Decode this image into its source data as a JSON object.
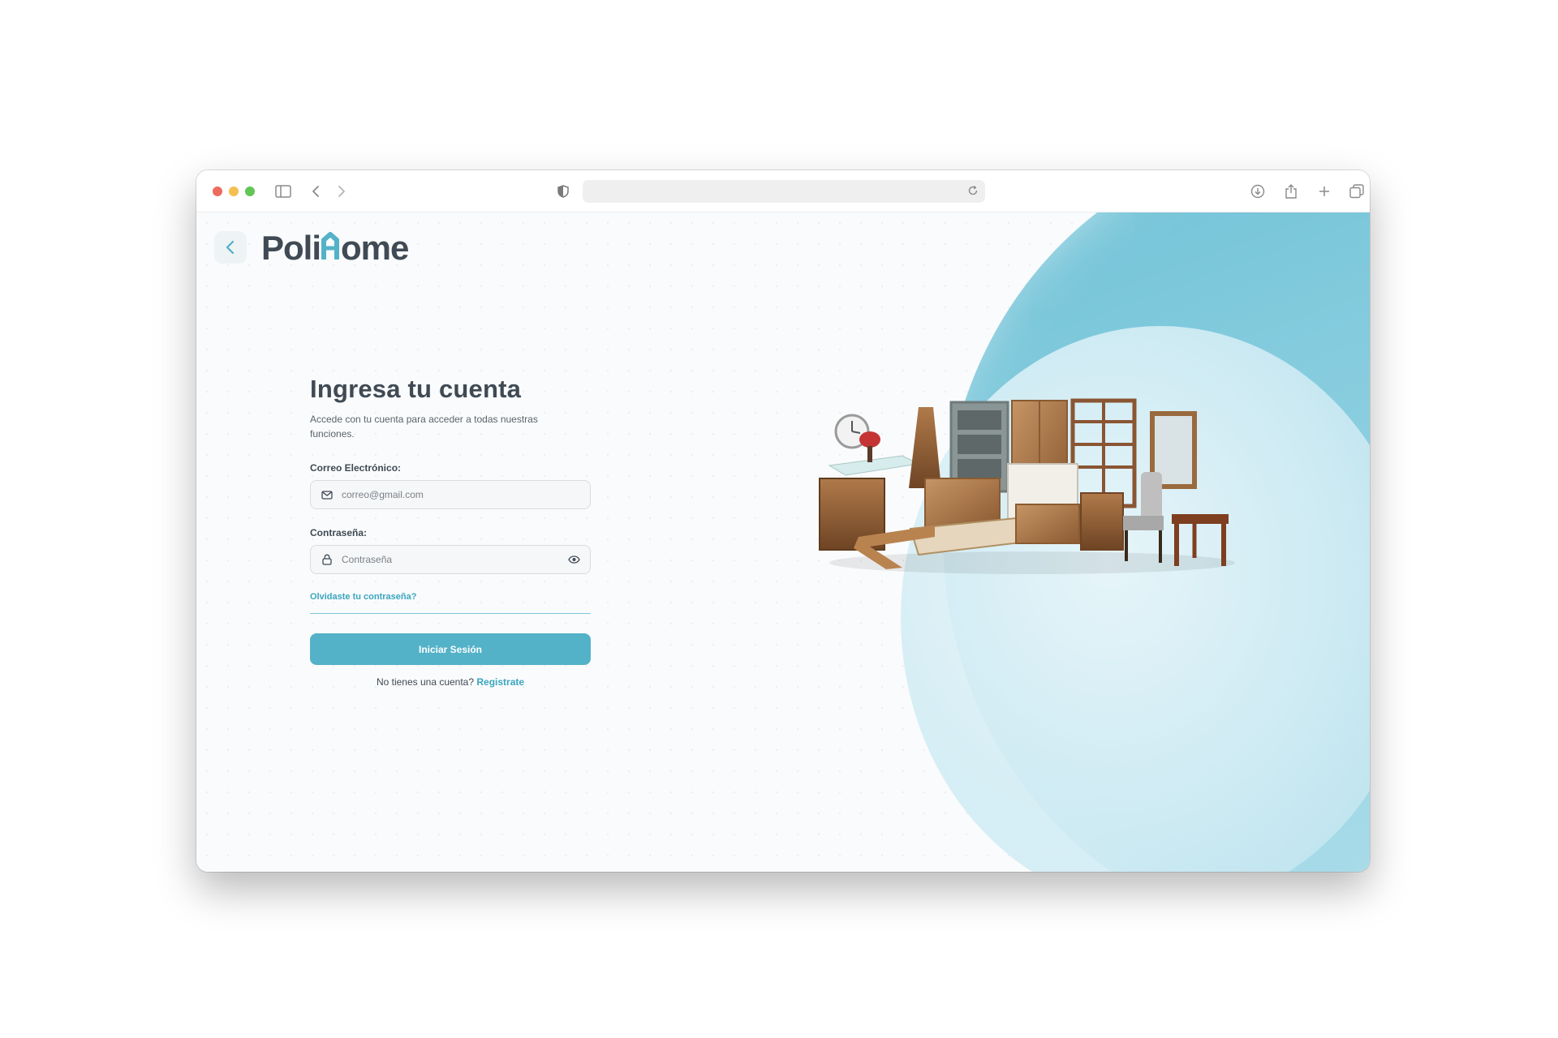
{
  "browser": {
    "url": "",
    "icons": [
      "sidebar-icon",
      "back-icon",
      "forward-icon",
      "shield-icon",
      "reload-icon",
      "download-icon",
      "share-icon",
      "plus-icon",
      "tabs-icon"
    ]
  },
  "brand": {
    "name": "Polihome",
    "accent": "#53b2c8",
    "text_color": "#3f4a54"
  },
  "login": {
    "title": "Ingresa tu cuenta",
    "subtitle": "Accede con tu cuenta para acceder a todas nuestras funciones.",
    "email_label": "Correo Electrónico:",
    "email_placeholder": "correo@gmail.com",
    "password_label": "Contraseña:",
    "password_placeholder": "Contraseña",
    "forgot_link": "Olvidaste tu contraseña?",
    "submit_label": "Iniciar Sesión",
    "signup_prompt": "No tienes una cuenta?",
    "signup_link": "Registrate"
  }
}
